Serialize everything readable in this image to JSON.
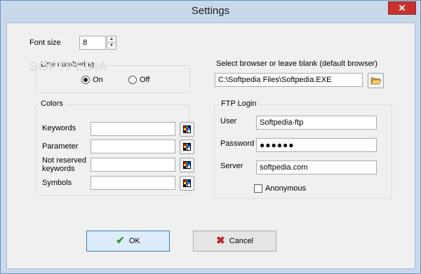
{
  "window": {
    "title": "Settings",
    "close_glyph": "✕"
  },
  "font_size": {
    "label": "Font size",
    "value": "8"
  },
  "line_numbering": {
    "label": "Line numbering",
    "on_label": "On",
    "off_label": "Off",
    "selected": "On"
  },
  "watermark": "SOFTPEDIA",
  "browser": {
    "label": "Select browser or leave blank (default browser)",
    "value": "C:\\Softpedia Files\\Softpedia.EXE",
    "folder_icon": "folder-open-icon"
  },
  "colors": {
    "title": "Colors",
    "rows": [
      {
        "label": "Keywords",
        "value": ""
      },
      {
        "label": "Parameter",
        "value": ""
      },
      {
        "label": "Not reserved keywords",
        "value": ""
      },
      {
        "label": "Symbols",
        "value": ""
      }
    ],
    "picker_icon": "color-picker-icon"
  },
  "ftp": {
    "title": "FTP Login",
    "user_label": "User",
    "user_value": "Softpedia-ftp",
    "password_label": "Password",
    "password_value": "●●●●●●",
    "server_label": "Server",
    "server_value": "softpedia.com",
    "anonymous_label": "Anonymous",
    "anonymous_checked": false
  },
  "buttons": {
    "ok_label": "OK",
    "ok_icon": "checkmark-icon",
    "cancel_label": "Cancel",
    "cancel_icon": "x-icon"
  },
  "accent_colors": {
    "ok_check": "#2e9e2e",
    "cancel_x": "#c0261e",
    "title_bar": "#c9d9ec"
  }
}
